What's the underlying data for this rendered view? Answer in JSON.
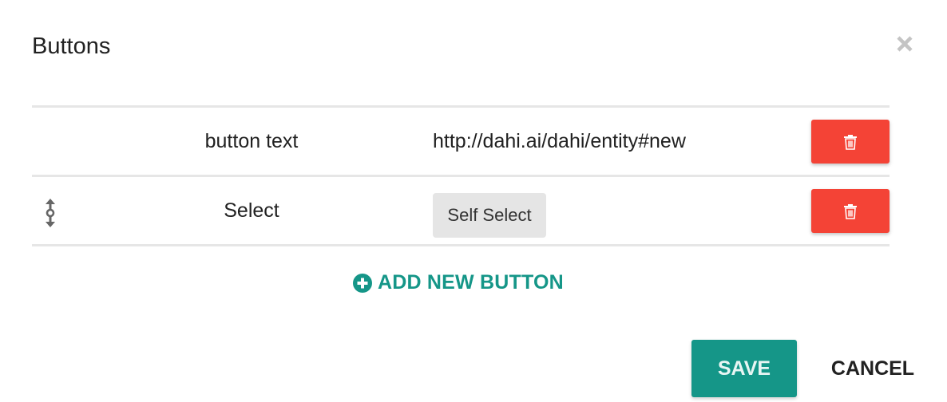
{
  "dialog": {
    "title": "Buttons"
  },
  "icons": {
    "close": "close-icon",
    "drag": "drag-handle-icon",
    "delete": "trash-icon",
    "add": "plus-circle-icon"
  },
  "rows": [
    {
      "label": "button text",
      "value": "http://dahi.ai/dahi/entity#new"
    },
    {
      "label": "Select",
      "type_label": "Self Select"
    }
  ],
  "actions": {
    "add_new": "ADD NEW BUTTON",
    "save": "SAVE",
    "cancel": "CANCEL"
  },
  "colors": {
    "accent": "#159688",
    "danger": "#f44336",
    "divider": "#e6e6e6",
    "chip": "#e5e5e5"
  }
}
